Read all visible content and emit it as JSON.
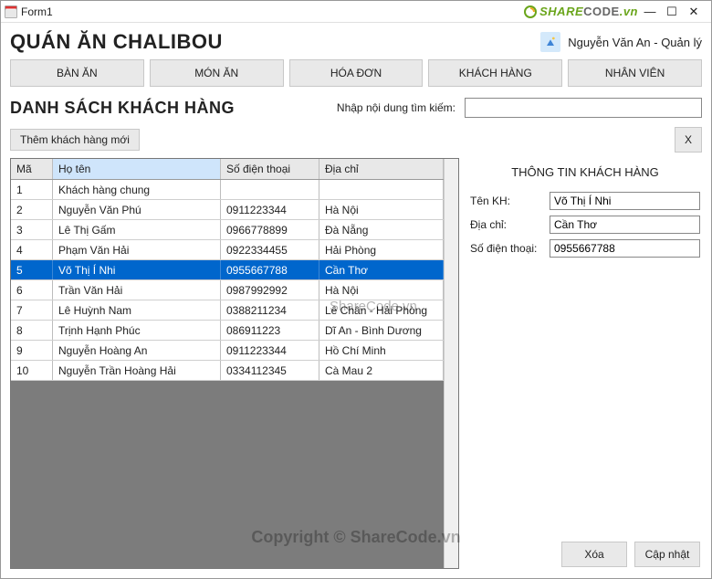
{
  "window": {
    "title": "Form1"
  },
  "logo": {
    "text_share": "SHARE",
    "text_code": "CODE",
    "tld": ".vn"
  },
  "sysbtns": {
    "min": "—",
    "max": "☐",
    "close": "✕"
  },
  "header": {
    "app_title": "QUÁN ĂN CHALIBOU",
    "user_label": "Nguyễn Văn An - Quản lý"
  },
  "nav": {
    "items": [
      "BÀN ĂN",
      "MÓN ĂN",
      "HÓA ĐƠN",
      "KHÁCH HÀNG",
      "NHÂN VIÊN"
    ]
  },
  "section": {
    "title": "DANH SÁCH KHÁCH HÀNG",
    "search_label": "Nhập nội dung tìm kiếm:",
    "search_value": ""
  },
  "toolbar": {
    "add_label": "Thêm khách hàng mới",
    "close_label": "X"
  },
  "grid": {
    "columns": {
      "id": "Mã",
      "name": "Họ tên",
      "phone": "Số điện thoại",
      "addr": "Địa chỉ"
    },
    "selected_column": "name",
    "selected_row_index": 4,
    "rows": [
      {
        "id": "1",
        "name": "Khách hàng chung",
        "phone": "",
        "addr": ""
      },
      {
        "id": "2",
        "name": "Nguyễn Văn Phú",
        "phone": "0911223344",
        "addr": "Hà Nội"
      },
      {
        "id": "3",
        "name": "Lê Thị Gấm",
        "phone": "0966778899",
        "addr": "Đà Nẵng"
      },
      {
        "id": "4",
        "name": "Phạm Văn Hải",
        "phone": "0922334455",
        "addr": "Hải Phòng"
      },
      {
        "id": "5",
        "name": "Võ Thị Í Nhi",
        "phone": "0955667788",
        "addr": "Cần Thơ"
      },
      {
        "id": "6",
        "name": "Trần Văn Hải",
        "phone": "0987992992",
        "addr": "Hà Nội"
      },
      {
        "id": "7",
        "name": "Lê Huỳnh Nam",
        "phone": "0388211234",
        "addr": "Lê Chân - Hải Phòng"
      },
      {
        "id": "8",
        "name": "Trịnh Hạnh Phúc",
        "phone": "086911223",
        "addr": "Dĩ An - Bình Dương"
      },
      {
        "id": "9",
        "name": "Nguyễn Hoàng An",
        "phone": "0911223344",
        "addr": "Hồ Chí Minh"
      },
      {
        "id": "10",
        "name": "Nguyễn Trần Hoàng Hải",
        "phone": "0334112345",
        "addr": "Cà Mau 2"
      }
    ]
  },
  "detail": {
    "title": "THÔNG TIN KHÁCH HÀNG",
    "name_label": "Tên KH:",
    "addr_label": "Địa chỉ:",
    "phone_label": "Số điện thoại:",
    "name_value": "Võ Thị Í Nhi",
    "addr_value": "Cần Thơ",
    "phone_value": "0955667788",
    "delete_label": "Xóa",
    "update_label": "Cập nhật"
  },
  "watermark": {
    "big": "Copyright © ShareCode.vn",
    "small": "ShareCode.vn"
  }
}
